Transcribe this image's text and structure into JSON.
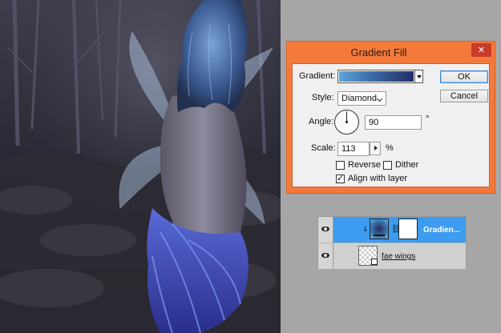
{
  "dialog": {
    "title": "Gradient Fill",
    "close_glyph": "✕",
    "gradient_label": "Gradient:",
    "gradient_colors": [
      "#5fa6d8",
      "#3a6aa6",
      "#232c66"
    ],
    "style_label": "Style:",
    "style_value": "Diamond",
    "angle_label": "Angle:",
    "angle_value": "90",
    "angle_unit": "°",
    "scale_label": "Scale:",
    "scale_value": "113",
    "scale_unit": "%",
    "reverse_label": "Reverse",
    "reverse_checked": false,
    "dither_label": "Dither",
    "dither_checked": false,
    "align_label": "Align with layer",
    "align_checked": true,
    "ok_label": "OK",
    "cancel_label": "Cancel"
  },
  "layers": [
    {
      "name": "Gradien...",
      "selected": true,
      "visible": true,
      "kind": "gradient-fill"
    },
    {
      "name": "fae wings",
      "selected": false,
      "visible": true,
      "kind": "smart-object"
    }
  ],
  "colors": {
    "dialog_border": "#f47a3c",
    "close_button": "#c83c2a",
    "selected_layer": "#3d9bf0",
    "workspace": "#a6a6a6"
  },
  "icons": {
    "close": "close-icon",
    "visibility": "eye-icon",
    "link": "chain-link-icon",
    "dropdown": "chevron-down-icon"
  }
}
